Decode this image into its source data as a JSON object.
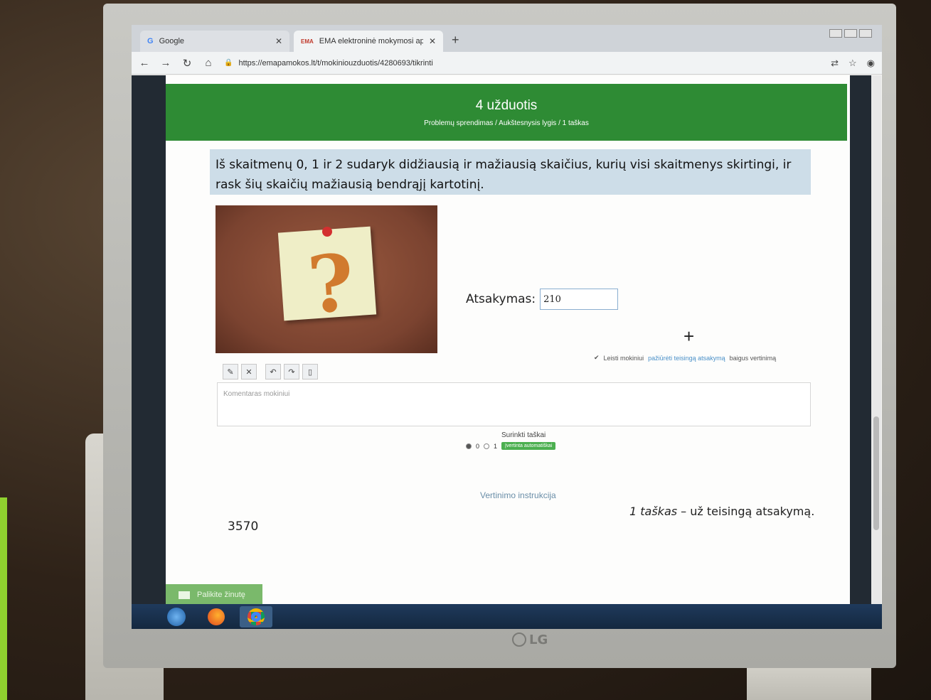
{
  "browser": {
    "tabs": [
      {
        "icon": "G",
        "label": "Google",
        "active": false
      },
      {
        "icon": "EMA",
        "label": "EMA elektroninė mokymosi aplin",
        "active": true
      }
    ],
    "url": "https://emapamokos.lt/t/mokiniouzduotis/4280693/tikrinti"
  },
  "task": {
    "title": "4 užduotis",
    "subtitle": "Problemų sprendimas / Aukštesnysis lygis / 1 taškas",
    "question": "Iš skaitmenų 0, 1 ir 2 sudaryk didžiausią ir mažiausią skaičius, kurių visi skaitmenys skirtingi, ir rask šių skaičių mažiausią bendrąjį kartotinį.",
    "answer_label": "Atsakymas:",
    "answer_value": "210"
  },
  "review": {
    "allow_prefix": "Leisti mokiniui",
    "allow_link": "pažiūrėti teisingą atsakymą",
    "allow_suffix": "baigus vertinimą",
    "comment_placeholder": "Komentaras mokiniui",
    "points_label": "Surinkti taškai",
    "points_options": [
      "0",
      "1"
    ],
    "points_selected": "0",
    "auto_badge": "Įvertinta automatiškai",
    "instructions_title": "Vertinimo instrukcija",
    "instructions_points": "1 taškas",
    "instructions_rest": " – už teisingą atsakymą.",
    "correct_answer": "3570"
  },
  "chat": {
    "label": "Palikite žinutę"
  },
  "colors": {
    "header_green": "#2e8b34",
    "question_bg": "#cddde8",
    "badge_green": "#4caf50"
  },
  "monitor_brand": "LG"
}
